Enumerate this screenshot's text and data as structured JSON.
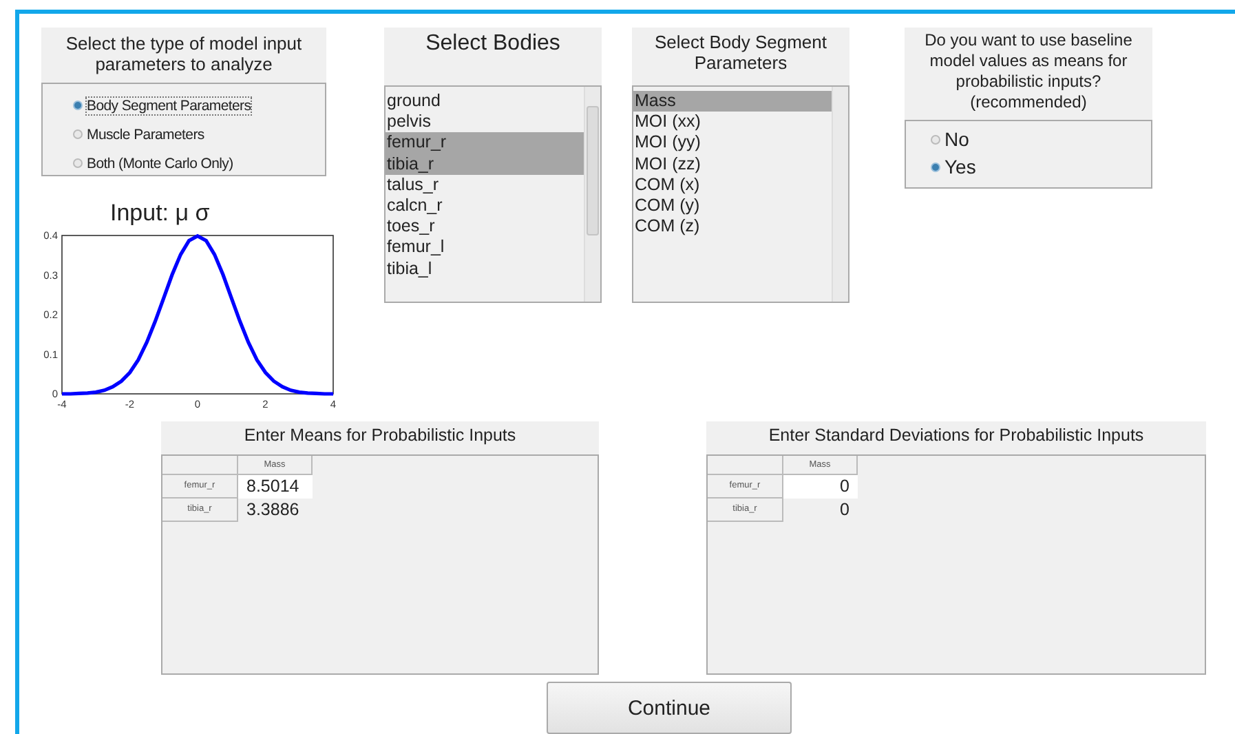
{
  "input_type": {
    "title": "Select the type of model input parameters to analyze",
    "options": [
      {
        "label": "Body Segment Parameters",
        "selected": true
      },
      {
        "label": "Muscle Parameters",
        "selected": false
      },
      {
        "label": "Both (Monte Carlo Only)",
        "selected": false
      }
    ]
  },
  "plot": {
    "title": "Input: μ σ",
    "chart_data": {
      "type": "line",
      "x": [
        -4,
        -3.75,
        -3.5,
        -3.25,
        -3,
        -2.75,
        -2.5,
        -2.25,
        -2,
        -1.75,
        -1.5,
        -1.25,
        -1,
        -0.75,
        -0.5,
        -0.25,
        0,
        0.25,
        0.5,
        0.75,
        1,
        1.25,
        1.5,
        1.75,
        2,
        2.25,
        2.5,
        2.75,
        3,
        3.25,
        3.5,
        3.75,
        4
      ],
      "series": [
        {
          "color": "#0000ff",
          "values": [
            0,
            0,
            0.001,
            0.002,
            0.004,
            0.009,
            0.018,
            0.032,
            0.054,
            0.086,
            0.13,
            0.183,
            0.242,
            0.301,
            0.352,
            0.387,
            0.399,
            0.387,
            0.352,
            0.301,
            0.242,
            0.183,
            0.13,
            0.086,
            0.054,
            0.032,
            0.018,
            0.009,
            0.004,
            0.002,
            0.001,
            0,
            0
          ]
        }
      ],
      "xlim": [
        -4,
        4
      ],
      "ylim": [
        0,
        0.4
      ],
      "xticks": [
        -4,
        -2,
        0,
        2,
        4
      ],
      "yticks": [
        0,
        0.1,
        0.2,
        0.3,
        0.4
      ]
    }
  },
  "bodies": {
    "title": "Select Bodies",
    "items": [
      {
        "label": "ground",
        "selected": false
      },
      {
        "label": "pelvis",
        "selected": false
      },
      {
        "label": "femur_r",
        "selected": true
      },
      {
        "label": "tibia_r",
        "selected": true
      },
      {
        "label": "talus_r",
        "selected": false
      },
      {
        "label": "calcn_r",
        "selected": false
      },
      {
        "label": "toes_r",
        "selected": false
      },
      {
        "label": "femur_l",
        "selected": false
      },
      {
        "label": "tibia_l",
        "selected": false
      }
    ]
  },
  "segment_parameters": {
    "title": "Select Body Segment Parameters",
    "items": [
      {
        "label": "Mass",
        "selected": true
      },
      {
        "label": "MOI (xx)",
        "selected": false
      },
      {
        "label": "MOI (yy)",
        "selected": false
      },
      {
        "label": "MOI (zz)",
        "selected": false
      },
      {
        "label": "COM (x)",
        "selected": false
      },
      {
        "label": "COM (y)",
        "selected": false
      },
      {
        "label": "COM (z)",
        "selected": false
      }
    ]
  },
  "baseline": {
    "title": "Do you want to use baseline model values as means for probabilistic inputs? (recommended)",
    "options": [
      {
        "label": "No",
        "selected": false
      },
      {
        "label": "Yes",
        "selected": true
      }
    ]
  },
  "means_table": {
    "title": "Enter Means for Probabilistic Inputs",
    "columns": [
      "Mass"
    ],
    "rows": [
      {
        "name": "femur_r",
        "values": [
          "8.5014"
        ]
      },
      {
        "name": "tibia_r",
        "values": [
          "3.3886"
        ]
      }
    ]
  },
  "sd_table": {
    "title": "Enter Standard Deviations for Probabilistic Inputs",
    "columns": [
      "Mass"
    ],
    "rows": [
      {
        "name": "femur_r",
        "values": [
          "0"
        ]
      },
      {
        "name": "tibia_r",
        "values": [
          "0"
        ]
      }
    ]
  },
  "continue_button": "Continue"
}
